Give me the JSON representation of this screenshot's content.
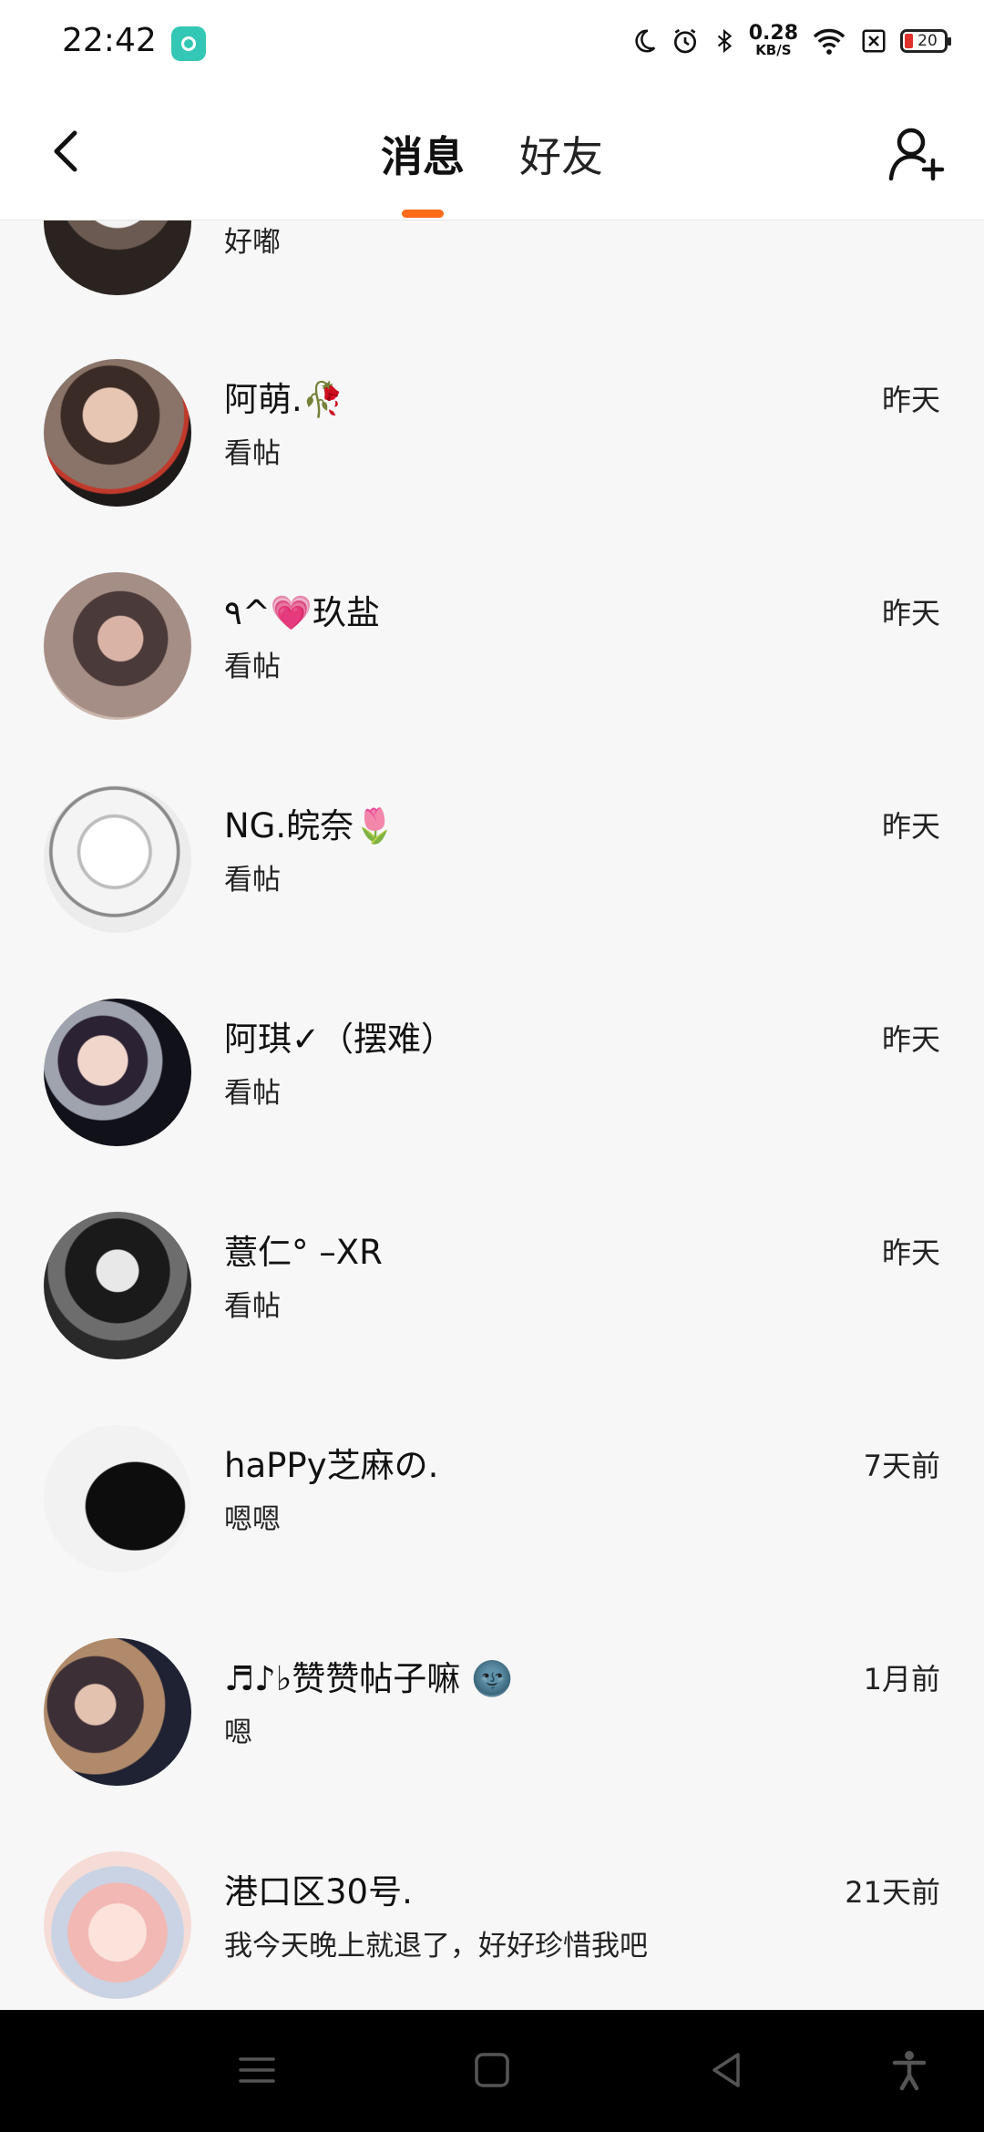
{
  "status_bar": {
    "time": "22:42",
    "net_speed_value": "0.28",
    "net_speed_unit": "KB/S",
    "battery": "20"
  },
  "header": {
    "tabs": [
      {
        "label": "消息",
        "active": true
      },
      {
        "label": "好友",
        "active": false
      }
    ],
    "accent_color": "#ff6a1a"
  },
  "messages": [
    {
      "name": "",
      "message": "好嘟",
      "time": ""
    },
    {
      "name": "阿萌.🥀",
      "message": "看帖",
      "time": "昨天"
    },
    {
      "name": "٩^💗玖盐",
      "message": "看帖",
      "time": "昨天"
    },
    {
      "name": "NG.皖奈🌷",
      "message": "看帖",
      "time": "昨天"
    },
    {
      "name": "阿琪✓（摆难）",
      "message": "看帖",
      "time": "昨天"
    },
    {
      "name": "薏仁° –XR",
      "message": "看帖",
      "time": "昨天"
    },
    {
      "name": "haPPy芝麻の.",
      "message": "嗯嗯",
      "time": "7天前"
    },
    {
      "name": "♬♪♭赞赞帖子嘛 🌚",
      "message": "嗯",
      "time": "1月前"
    },
    {
      "name": "港口区30号.",
      "message": "我今天晚上就退了，好好珍惜我吧",
      "time": "21天前"
    }
  ],
  "nav_bar": {
    "icons": [
      "menu-icon",
      "home-icon",
      "back-triangle-icon",
      "accessibility-icon"
    ]
  }
}
